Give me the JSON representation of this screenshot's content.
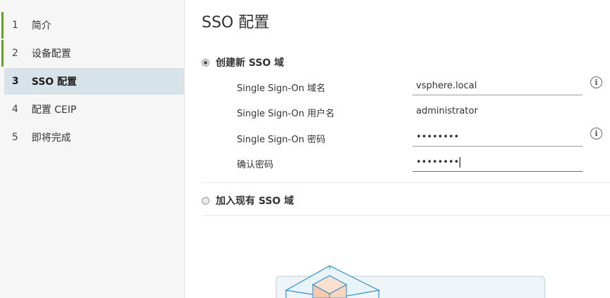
{
  "sidebar": {
    "steps": [
      {
        "num": "1",
        "label": "简介"
      },
      {
        "num": "2",
        "label": "设备配置"
      },
      {
        "num": "3",
        "label": "SSO 配置"
      },
      {
        "num": "4",
        "label": "配置 CEIP"
      },
      {
        "num": "5",
        "label": "即将完成"
      }
    ]
  },
  "main": {
    "title": "SSO 配置",
    "option_new": "创建新 SSO 域",
    "option_join": "加入现有 SSO 域",
    "fields": [
      {
        "label": "Single Sign-On 域名",
        "value": "vsphere.local"
      },
      {
        "label": "Single Sign-On 用户名",
        "value": "administrator"
      },
      {
        "label": "Single Sign-On 密码",
        "value": "••••••••"
      },
      {
        "label": "确认密码",
        "value": "••••••••"
      }
    ],
    "info_glyph": "i"
  },
  "colors": {
    "completed_bar": "#62a420",
    "active_step_bg": "#d8e3e9",
    "illustration_stroke": "#2f8fc8"
  }
}
